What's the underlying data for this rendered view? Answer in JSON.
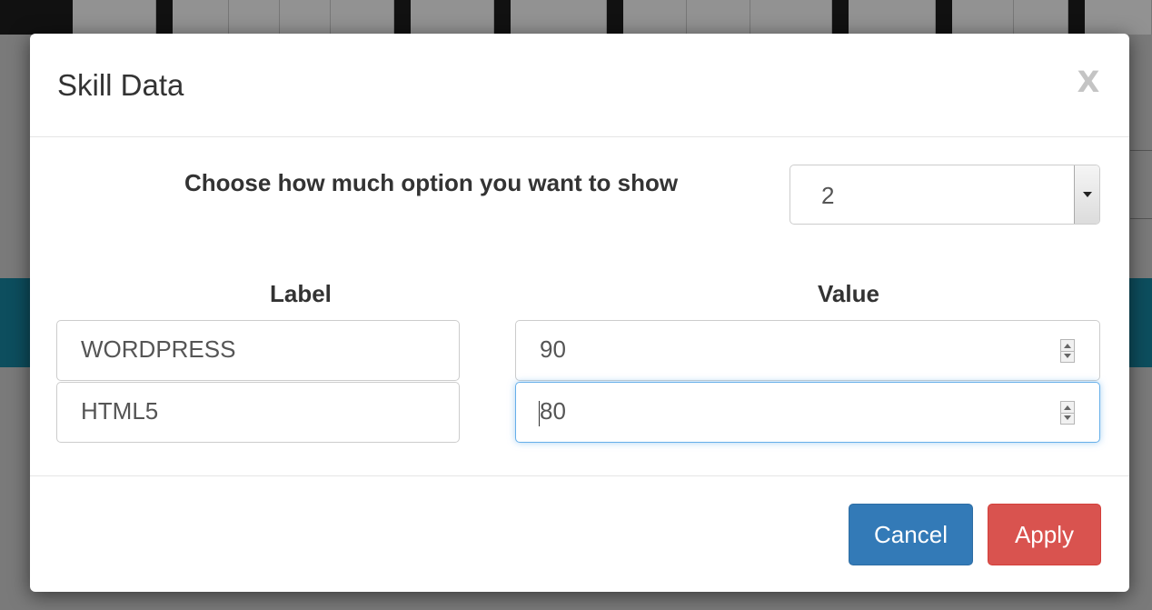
{
  "modal": {
    "title": "Skill Data",
    "close_label": "X",
    "choose_label": "Choose how much option you want to show",
    "option_count": "2",
    "columns": {
      "label": "Label",
      "value": "Value"
    },
    "rows": [
      {
        "label": "WORDPRESS",
        "value": "90"
      },
      {
        "label": "HTML5",
        "value": "80"
      }
    ],
    "buttons": {
      "cancel": "Cancel",
      "apply": "Apply"
    }
  },
  "colors": {
    "cancel": "#337ab7",
    "apply": "#d9534f",
    "focus_border": "#66afe9"
  },
  "icons": [
    "close-icon",
    "chevron-down-icon",
    "spinner-up-icon",
    "spinner-down-icon"
  ]
}
